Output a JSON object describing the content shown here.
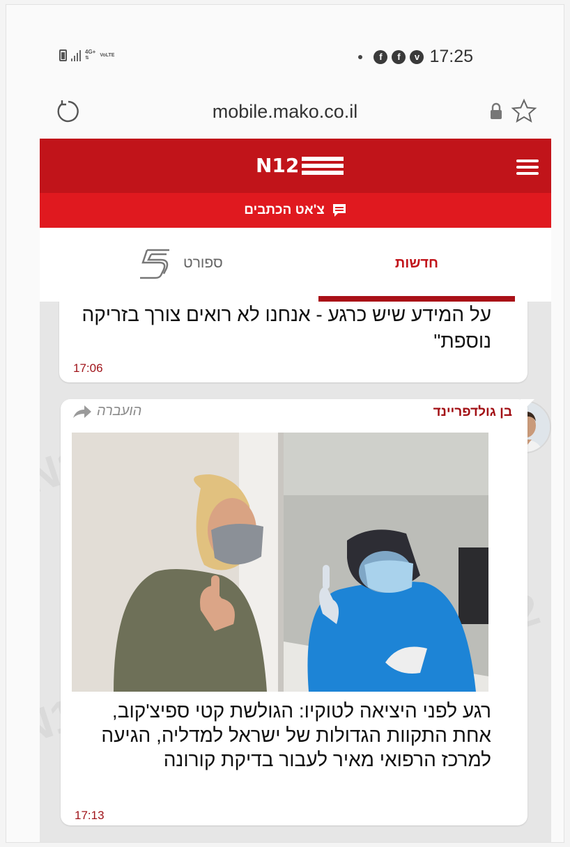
{
  "status_bar": {
    "network_4g": "4G+",
    "network_volte": "VoLTE",
    "time": "17:25",
    "notification_icons": [
      "facebook-icon",
      "facebook-icon",
      "viber-icon"
    ]
  },
  "browser": {
    "url": "mobile.mako.co.il"
  },
  "header": {
    "logo_text": "N12",
    "chat_label": "צ'אט הכתבים",
    "brand_color": "#c1141a"
  },
  "tabs": {
    "news": "חדשות",
    "sport": "ספורט"
  },
  "feed": {
    "messages": [
      {
        "text": "על המידע שיש כרגע - אנחנו לא רואים צורך בזריקה נוספת\"",
        "time": "17:06"
      },
      {
        "author": "בן גולדפריינד",
        "forwarded_label": "הועברה",
        "text": "רגע לפני היציאה לטוקיו: הגולשת קטי ספיצ'קוב, אחת התקוות הגדולות של ישראל למדליה, הגיעה למרכז הרפואי מאיר לעבור בדיקת קורונה",
        "time": "17:13"
      }
    ]
  }
}
